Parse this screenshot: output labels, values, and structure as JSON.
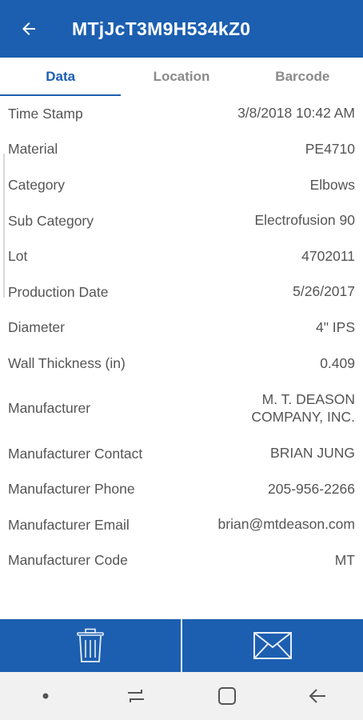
{
  "appbar": {
    "title": "MTjJcT3M9H534kZ0",
    "back_icon": "arrow-back-icon"
  },
  "tabs": [
    {
      "label": "Data",
      "active": true
    },
    {
      "label": "Location",
      "active": false
    },
    {
      "label": "Barcode",
      "active": false
    }
  ],
  "details": [
    {
      "label": "Time Stamp",
      "value": "3/8/2018 10:42 AM"
    },
    {
      "label": "Material",
      "value": "PE4710"
    },
    {
      "label": "Category",
      "value": "Elbows"
    },
    {
      "label": "Sub Category",
      "value": "Electrofusion 90"
    },
    {
      "label": "Lot",
      "value": "4702011"
    },
    {
      "label": "Production Date",
      "value": "5/26/2017"
    },
    {
      "label": "Diameter",
      "value": "4\" IPS"
    },
    {
      "label": "Wall Thickness (in)",
      "value": "0.409"
    },
    {
      "label": "Manufacturer",
      "value": "M. T. DEASON\nCOMPANY, INC."
    },
    {
      "label": "Manufacturer Contact",
      "value": "BRIAN JUNG"
    },
    {
      "label": "Manufacturer Phone",
      "value": "205-956-2266"
    },
    {
      "label": "Manufacturer Email",
      "value": "brian@mtdeason.com"
    },
    {
      "label": "Manufacturer Code",
      "value": "MT"
    }
  ],
  "actions": {
    "delete_icon": "trash-icon",
    "email_icon": "envelope-icon"
  },
  "colors": {
    "primary": "#1c5fb0",
    "text": "#555555",
    "tab_inactive": "#8a8a8a"
  }
}
